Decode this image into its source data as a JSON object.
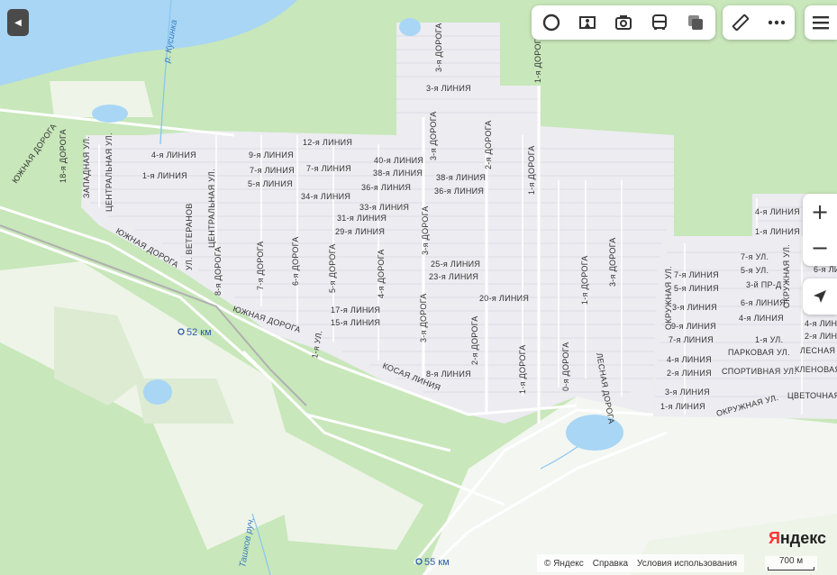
{
  "map": {
    "river_label": "р. Кусинка",
    "river2_label": "Ташков руч.",
    "km_markers": [
      "52 км",
      "55 км"
    ],
    "streets_main": [
      "3-я ЛИНИЯ",
      "12-я ЛИНИЯ",
      "4-я ЛИНИЯ",
      "9-я ЛИНИЯ",
      "40-я ЛИНИЯ",
      "1-я ЛИНИЯ",
      "7-я ЛИНИЯ",
      "7-я ЛИНИЯ",
      "38-я ЛИНИЯ",
      "5-я ЛИНИЯ",
      "36-я ЛИНИЯ",
      "38-я ЛИНИЯ",
      "36-я ЛИНИЯ",
      "34-я ЛИНИЯ",
      "33-я ЛИНИЯ",
      "31-я ЛИНИЯ",
      "29-я ЛИНИЯ",
      "25-я ЛИНИЯ",
      "23-я ЛИНИЯ",
      "20-я ЛИНИЯ",
      "17-я ЛИНИЯ",
      "15-я ЛИНИЯ",
      "8-я ЛИНИЯ",
      "КОСАЯ ЛИНИЯ",
      "ЮЖНАЯ ДОРОГА",
      "ЮЖНАЯ ДОРОГА",
      "ЮЖНАЯ ДОРОГА"
    ],
    "roads_vertical": [
      "3-я ДОРОГА",
      "1-я ДОРОГА",
      "3-я ДОРОГА",
      "2-я ДОРОГА",
      "1-я ДОРОГА",
      "18-я ДОРОГА",
      "ЗАПАДНАЯ УЛ.",
      "ЦЕНТРАЛЬНАЯ УЛ.",
      "ЦЕНТРАЛЬНАЯ УЛ.",
      "УЛ. ВЕТЕРАНОВ",
      "8-я ДОРОГА",
      "7-я ДОРОГА",
      "6-я ДОРОГА",
      "5-я ДОРОГА",
      "4-я ДОРОГА",
      "3-я ДОРОГА",
      "3-я ДОРОГА",
      "2-я ДОРОГА",
      "1-я ДОРОГА",
      "0-я ДОРОГА",
      "1-я ДОРОГА",
      "3-я ДОРОГА",
      "1-я УЛ.",
      "ЛЕСНАЯ ДОРОГА"
    ],
    "streets_east": [
      "4-я ЛИНИЯ",
      "1-я ЛИНИЯ",
      "7-я УЛ.",
      "5-я УЛ.",
      "3-й ПР-Д",
      "6-я ЛИНИЯ",
      "7-я ЛИНИЯ",
      "5-я ЛИНИЯ",
      "3-я ЛИНИЯ",
      "4-я ЛИНИЯ",
      "9-я ЛИНИЯ",
      "1-я УЛ.",
      "7-я ЛИНИЯ",
      "ПАРКОВАЯ УЛ.",
      "4-я ЛИНИЯ",
      "2-я ЛИНИЯ",
      "СПОРТИВНАЯ УЛ.",
      "3-я ЛИНИЯ",
      "1-я ЛИНИЯ",
      "ОКРУЖНАЯ УЛ.",
      "ОКРУЖНАЯ УЛ.",
      "ОКРУЖНАЯ УЛ.",
      "6-я ЛИ",
      "4-я ЛИН",
      "2-я ЛИН",
      "ЛЕСНАЯ",
      "КЛЕНОВАЯ",
      "ЦВЕТОЧНАЯ"
    ]
  },
  "toolbar": {
    "icons": [
      "layers-icon",
      "panorama-icon",
      "camera-icon",
      "bus-icon",
      "copy-icon"
    ],
    "ruler_icon": "ruler-icon",
    "more_icon": "more-icon",
    "menu_icon": "menu-icon"
  },
  "controls": {
    "zoom_in": "+",
    "zoom_out": "−"
  },
  "branding": {
    "logo_y": "Я",
    "logo_rest": "ндекс"
  },
  "footer": {
    "copyright": "© Яндекс",
    "help": "Справка",
    "terms": "Условия использования"
  },
  "scale": {
    "label": "700 м"
  },
  "colors": {
    "forest": "#c6e6b8",
    "open": "#eef4e8",
    "settlement": "#ededf2",
    "water": "#a9d6f5",
    "road": "#ffffff"
  }
}
